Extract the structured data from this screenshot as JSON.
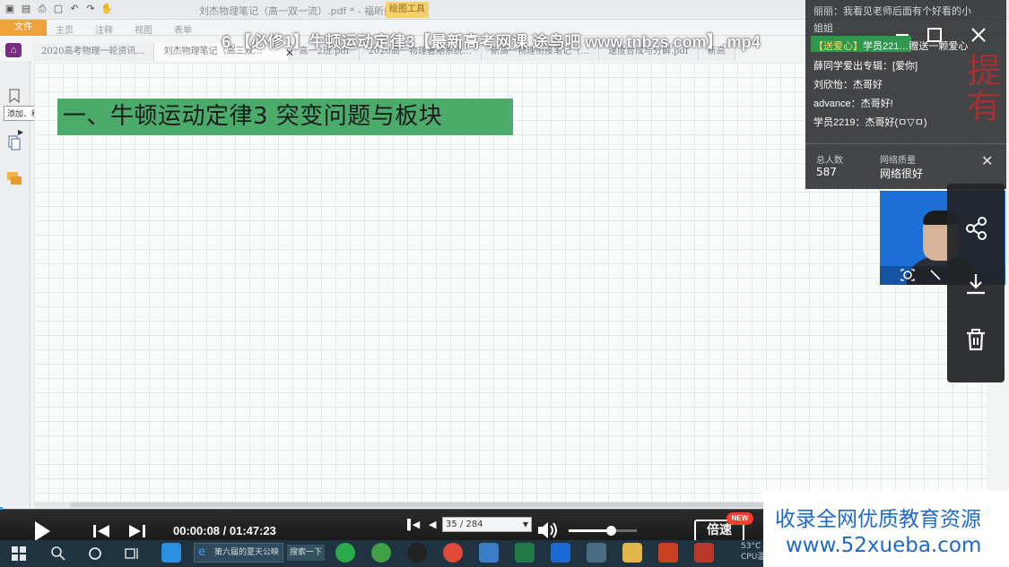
{
  "video": {
    "title": "6.【必修1】牛顿运动定律3【最新高考网课 途鸟吧 www.tnbzs.com】.mp4"
  },
  "pdf_app": {
    "title_text": "刘杰物理笔记（高一双一流）.pdf * - 福昕阅读器",
    "context_tab": "绘图工具",
    "file_tab": "文件",
    "ribbon_tabs": [
      "主页",
      "注释",
      "视图",
      "表单"
    ],
    "doc_tabs": [
      "2020高考物理一轮资讯…",
      "刘杰物理笔记（高三双…",
      "高一2班.pdf",
      "2020高一物理暑期系统…",
      "新高一物理衔接笔记（…",
      "速度合成与分解.pdf",
      "新高"
    ],
    "tooltip": "添加、移除、管理书签",
    "heading": "一、牛顿运动定律3  突变问题与板块"
  },
  "chat": {
    "messages": [
      {
        "text": "丽丽：我看见老师后面有个好看的小"
      },
      {
        "text": "姐姐"
      },
      {
        "text": "学员221…赠送一颗爱心",
        "prefix": "【送爱心】"
      },
      {
        "text": "薛同学爱出专辑：[爱你]"
      },
      {
        "text": "刘欣怡：杰哥好"
      },
      {
        "text": "advance：杰哥好!"
      },
      {
        "text": "学员2219：杰哥好(ㅁ▽ㅁ)"
      }
    ],
    "background_chars": [
      "提",
      "有"
    ],
    "stats": {
      "total_label": "总人数",
      "total_value": "587",
      "network_label": "网络质量",
      "network_value": "网络很好"
    }
  },
  "side_menu": {
    "items": [
      "share-icon",
      "download-icon",
      "trash-icon"
    ]
  },
  "player": {
    "time": "00:00:08 / 01:47:23",
    "progress_fraction": 0.0012,
    "page_nav": "35 / 284",
    "volume_fraction": 0.62,
    "speed_label": "倍速",
    "new_badge": "NEW"
  },
  "taskbar": {
    "window_label": "第六届的夏天公映",
    "search_label": "搜索一下",
    "temperature": "53°C",
    "cpu_label": "CPU温度"
  },
  "watermark": {
    "line1": "收录全网优质教育资源",
    "line2": "www.52xueba.com"
  },
  "colors": {
    "heading_bar": "#4aab6b",
    "accent_blue": "#1f69c7",
    "progress": "#29a0ff"
  }
}
